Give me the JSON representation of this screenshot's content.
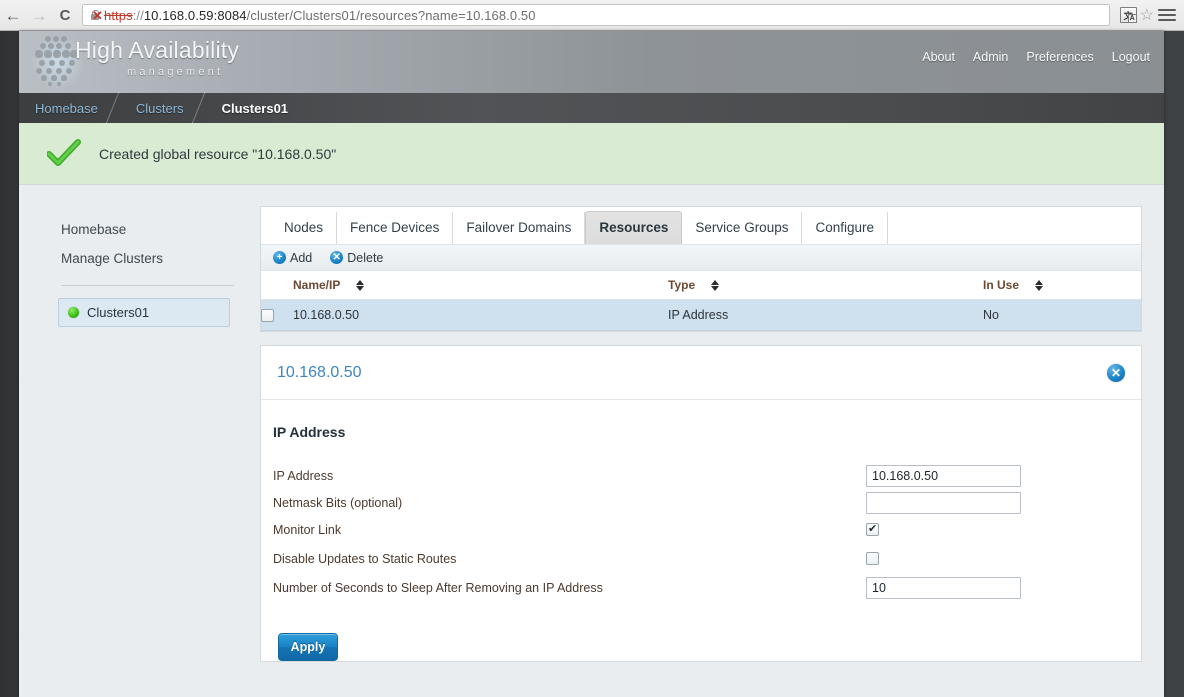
{
  "browser": {
    "back_icon": "back-arrow-icon",
    "forward_icon": "forward-arrow-icon",
    "reload_icon": "reload-icon",
    "security": {
      "state": "insecure",
      "lock_icon": "broken-lock-icon",
      "x_mark": "✕"
    },
    "url": {
      "full": "https://10.168.0.59:8084/cluster/Clusters01/resources?name=10.168.0.50",
      "scheme": "https",
      "separator": "://",
      "host": "10.168.0.59:8084",
      "path": "/cluster/Clusters01/resources?name=10.168.0.50"
    },
    "translate_icon_cjk": "文",
    "translate_icon_latin": "A",
    "star_icon": "☆",
    "menu_icon": "hamburger-menu-icon"
  },
  "header": {
    "brand_title": "High Availability",
    "brand_subtitle": "management",
    "links": [
      {
        "label": "About"
      },
      {
        "label": "Admin"
      },
      {
        "label": "Preferences"
      },
      {
        "label": "Logout"
      }
    ]
  },
  "breadcrumb": {
    "items": [
      {
        "label": "Homebase",
        "current": false
      },
      {
        "label": "Clusters",
        "current": false
      },
      {
        "label": "Clusters01",
        "current": true
      }
    ]
  },
  "alert": {
    "icon": "green-checkmark-icon",
    "message": "Created global resource \"10.168.0.50\"",
    "background": "#d9ebd3"
  },
  "sidebar": {
    "links": [
      {
        "label": "Homebase"
      },
      {
        "label": "Manage Clusters"
      }
    ],
    "cluster": {
      "label": "Clusters01",
      "status": "online",
      "status_color": "#3fc018"
    }
  },
  "main": {
    "tabs": [
      {
        "label": "Nodes",
        "active": false
      },
      {
        "label": "Fence Devices",
        "active": false
      },
      {
        "label": "Failover Domains",
        "active": false
      },
      {
        "label": "Resources",
        "active": true
      },
      {
        "label": "Service Groups",
        "active": false
      },
      {
        "label": "Configure",
        "active": false
      }
    ],
    "toolbar": {
      "add_label": "Add",
      "add_icon": "+",
      "delete_label": "Delete",
      "delete_icon": "✕"
    },
    "table": {
      "columns": [
        {
          "label": "Name/IP",
          "sortable": true
        },
        {
          "label": "Type",
          "sortable": true
        },
        {
          "label": "In Use",
          "sortable": true
        }
      ],
      "rows": [
        {
          "selected": false,
          "name": "10.168.0.50",
          "type": "IP Address",
          "in_use": "No"
        }
      ]
    }
  },
  "detail": {
    "title": "10.168.0.50",
    "close_icon": "✕",
    "section_heading": "IP Address",
    "fields": [
      {
        "label": "IP Address",
        "kind": "text",
        "value": "10.168.0.50"
      },
      {
        "label": "Netmask Bits (optional)",
        "kind": "text",
        "value": ""
      },
      {
        "label": "Monitor Link",
        "kind": "checkbox",
        "checked": true
      },
      {
        "label": "Disable Updates to Static Routes",
        "kind": "checkbox",
        "checked": false
      },
      {
        "label": "Number of Seconds to Sleep After Removing an IP Address",
        "kind": "text",
        "value": "10"
      }
    ],
    "apply_label": "Apply"
  },
  "colors": {
    "accent_blue": "#1b85c9",
    "link_blue": "#3c86c6",
    "success_green": "#d9ebd3",
    "row_highlight": "#cfe0ef"
  }
}
